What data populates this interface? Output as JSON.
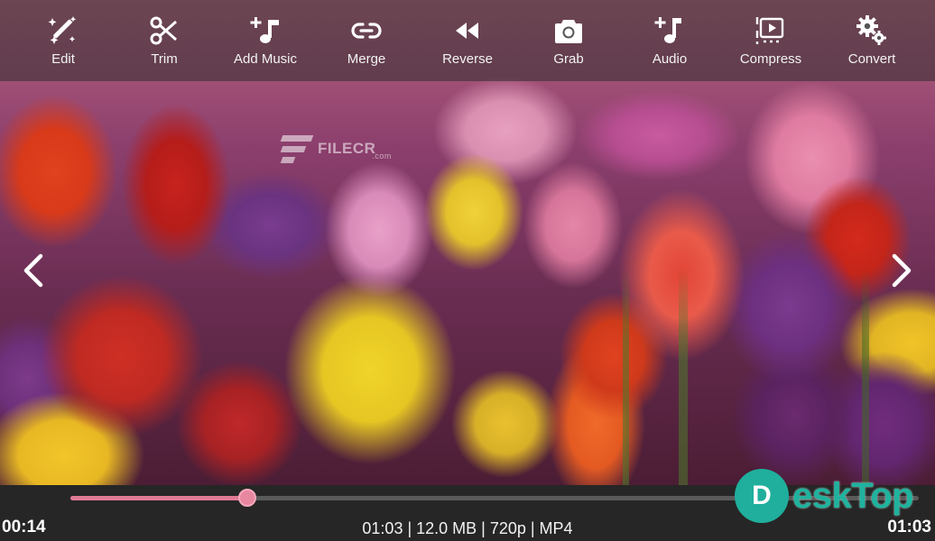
{
  "toolbar": {
    "items": [
      {
        "label": "Edit",
        "icon": "magic-wand-icon"
      },
      {
        "label": "Trim",
        "icon": "scissors-icon"
      },
      {
        "label": "Add Music",
        "icon": "add-music-icon"
      },
      {
        "label": "Merge",
        "icon": "link-icon"
      },
      {
        "label": "Reverse",
        "icon": "rewind-icon"
      },
      {
        "label": "Grab",
        "icon": "camera-icon"
      },
      {
        "label": "Audio",
        "icon": "audio-note-icon"
      },
      {
        "label": "Compress",
        "icon": "compress-icon"
      },
      {
        "label": "Convert",
        "icon": "gears-icon"
      }
    ]
  },
  "video": {
    "watermark": "FILECR",
    "watermark_suffix": ".com"
  },
  "player": {
    "current_time": "00:14",
    "duration": "01:03",
    "info": "01:03 | 12.0 MB | 720p | MP4",
    "progress": 0.209,
    "accent_color": "#e07b95"
  },
  "brand": {
    "letter": "D",
    "text": "eskTop"
  }
}
